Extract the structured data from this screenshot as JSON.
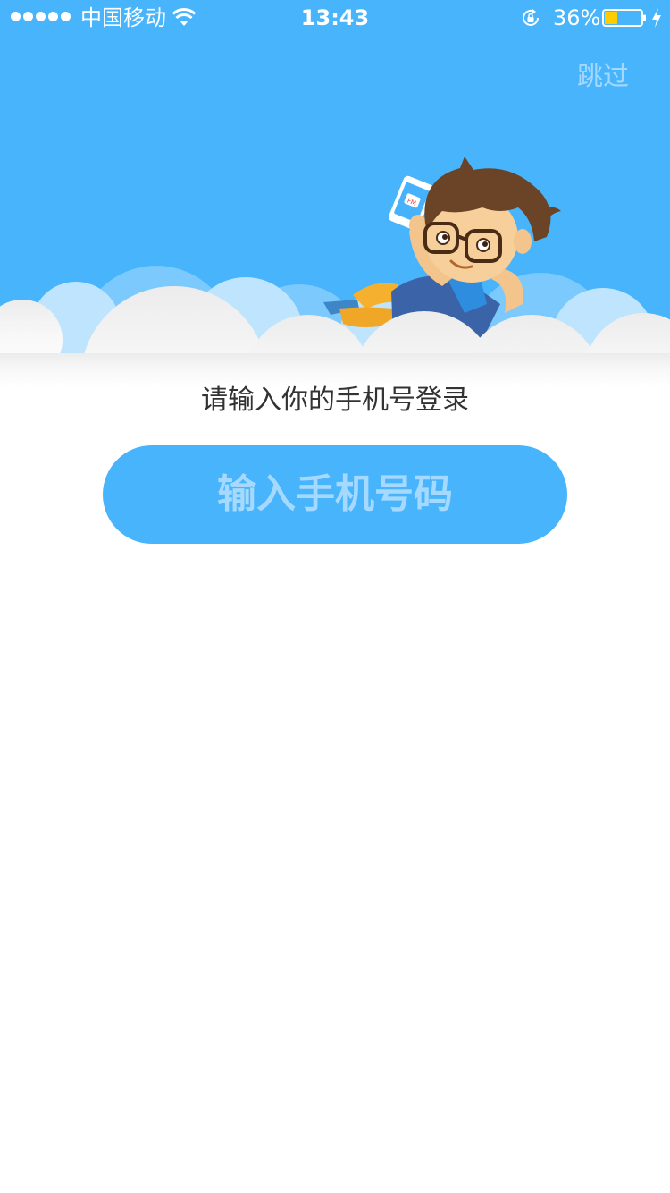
{
  "status_bar": {
    "carrier": "中国移动",
    "time": "13:43",
    "battery_percent": "36%",
    "battery_level": 0.36,
    "signal_bars": 5,
    "icons": [
      "signal-dots-icon",
      "wifi-icon",
      "rotation-lock-icon",
      "battery-icon",
      "charging-bolt-icon"
    ]
  },
  "header": {
    "skip_label": "跳过",
    "background_color": "#47b4fc",
    "skip_color": "#a3d8ff"
  },
  "main": {
    "prompt": "请输入你的手机号登录",
    "phone_button_label": "输入手机号码",
    "button_color": "#47b4fc",
    "button_text_color": "#a6d9ff"
  }
}
